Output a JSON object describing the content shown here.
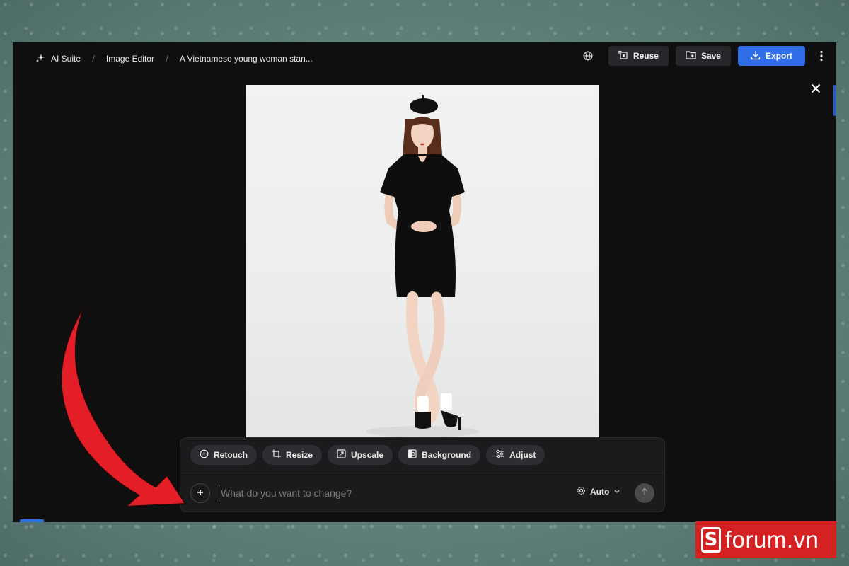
{
  "breadcrumb": {
    "app": "AI Suite",
    "section": "Image Editor",
    "file": "A Vietnamese young woman stan..."
  },
  "toolbar": {
    "reuse_label": "Reuse",
    "save_label": "Save",
    "export_label": "Export"
  },
  "tools": [
    {
      "label": "Retouch",
      "icon": "retouch-icon"
    },
    {
      "label": "Resize",
      "icon": "crop-icon"
    },
    {
      "label": "Upscale",
      "icon": "upscale-icon"
    },
    {
      "label": "Background",
      "icon": "background-icon"
    },
    {
      "label": "Adjust",
      "icon": "sliders-icon"
    }
  ],
  "prompt": {
    "placeholder": "What do you want to change?",
    "mode_label": "Auto"
  },
  "watermark": {
    "text": "forum.vn",
    "letter": "S"
  },
  "colors": {
    "accent": "#2f6ee6",
    "brand": "#d52121",
    "arrow": "#e41e26"
  }
}
